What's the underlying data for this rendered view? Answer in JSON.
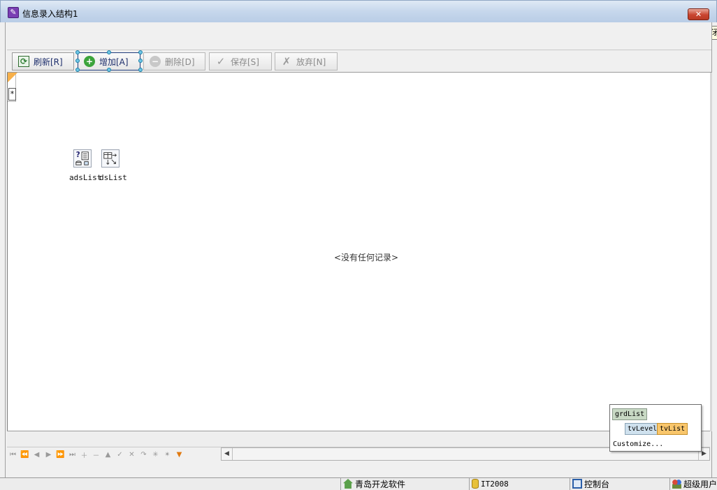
{
  "window": {
    "title": "信息录入结构1",
    "close_tooltip": "关闭"
  },
  "toolbar": {
    "refresh": "刷新[R]",
    "add": "增加[A]",
    "delete": "删除[D]",
    "save": "保存[S]",
    "discard": "放弃[N]"
  },
  "grid": {
    "new_row_marker": "*",
    "empty_text": "<没有任何记录>"
  },
  "components": [
    {
      "label": "adsList",
      "icon": "query-component-icon"
    },
    {
      "label": "dsList",
      "icon": "datasource-component-icon"
    }
  ],
  "level_popup": {
    "root": "grdList",
    "levels": [
      "tvLevel",
      "tvList"
    ],
    "customize": "Customize..."
  },
  "statusbar": {
    "company": "青岛开龙软件",
    "database": "IT2008",
    "console": "控制台",
    "user": "超级用户"
  },
  "colors": {
    "accent_selected": "#1f3b7a",
    "handle": "#6ec6e6",
    "active_level": "#f9c66b"
  }
}
